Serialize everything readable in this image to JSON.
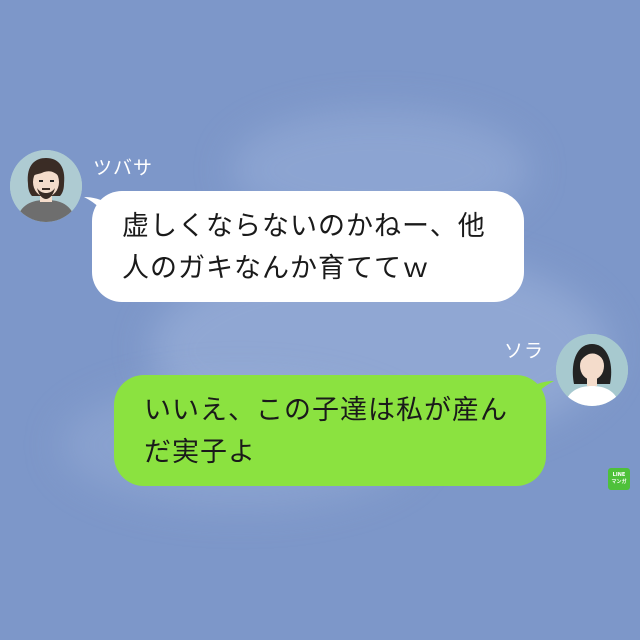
{
  "chat": {
    "messages": [
      {
        "sender": "ツバサ",
        "side": "left",
        "avatar_icon": "bearded-man-avatar-icon",
        "bubble_color": "#ffffff",
        "text": "虚しくならないのかねー、他\n人のガキなんか育ててｗ"
      },
      {
        "sender": "ソラ",
        "side": "right",
        "avatar_icon": "woman-avatar-icon",
        "bubble_color": "#8be240",
        "text": "いいえ、この子達は私が産ん\nだ実子よ"
      }
    ]
  },
  "watermark": {
    "icon": "line-manga-logo-icon",
    "line1": "LINE",
    "line2": "マンガ",
    "color": "#4ec13a"
  },
  "colors": {
    "background": "#7d97c9",
    "name_text": "#ffffff"
  }
}
